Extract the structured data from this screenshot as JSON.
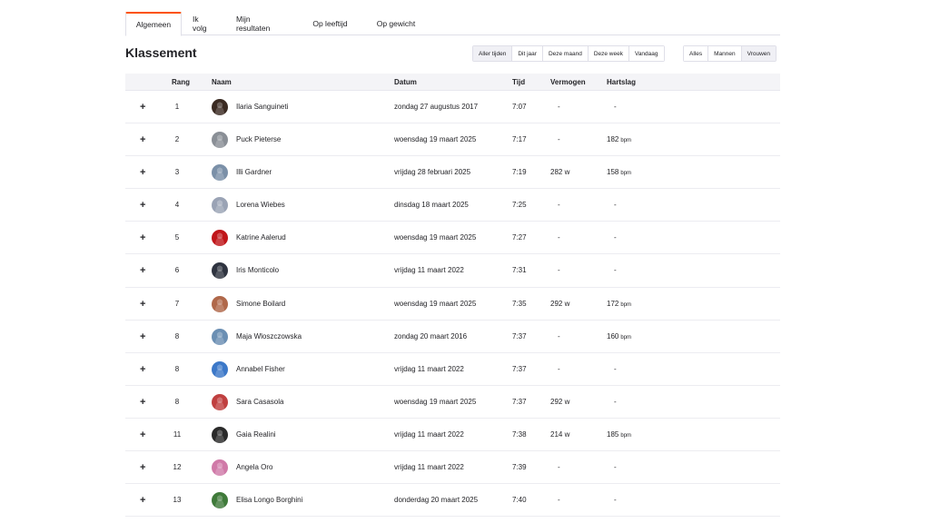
{
  "tabs": [
    "Algemeen",
    "Ik volg",
    "Mijn resultaten",
    "Op leeftijd",
    "Op gewicht"
  ],
  "page_title": "Klassement",
  "time_filters": [
    "Aller tijden",
    "Dit jaar",
    "Deze maand",
    "Deze week",
    "Vandaag"
  ],
  "gender_filters": [
    "Alles",
    "Mannen",
    "Vrouwen"
  ],
  "columns": {
    "rank": "Rang",
    "name": "Naam",
    "date": "Datum",
    "time": "Tijd",
    "power": "Vermogen",
    "hr": "Hartslag"
  },
  "expand_symbol": "+",
  "rows": [
    {
      "rank": "1",
      "name": "Ilaria Sanguineti",
      "date": "zondag 27 augustus 2017",
      "time": "7:07",
      "power": "-",
      "hr": "-",
      "hr_unit": "",
      "avatar_color": "#3a2a22"
    },
    {
      "rank": "2",
      "name": "Puck Pieterse",
      "date": "woensdag 19 maart 2025",
      "time": "7:17",
      "power": "-",
      "hr": "182",
      "hr_unit": "bpm",
      "avatar_color": "#8a8f96"
    },
    {
      "rank": "3",
      "name": "Illi Gardner",
      "date": "vrijdag 28 februari 2025",
      "time": "7:19",
      "power": "282 w",
      "hr": "158",
      "hr_unit": "bpm",
      "avatar_color": "#7b90a8"
    },
    {
      "rank": "4",
      "name": "Lorena Wiebes",
      "date": "dinsdag 18 maart 2025",
      "time": "7:25",
      "power": "-",
      "hr": "-",
      "hr_unit": "",
      "avatar_color": "#9aa3b5"
    },
    {
      "rank": "5",
      "name": "Katrine Aalerud",
      "date": "woensdag 19 maart 2025",
      "time": "7:27",
      "power": "-",
      "hr": "-",
      "hr_unit": "",
      "avatar_color": "#c0161a"
    },
    {
      "rank": "6",
      "name": "Iris Monticolo",
      "date": "vrijdag 11 maart 2022",
      "time": "7:31",
      "power": "-",
      "hr": "-",
      "hr_unit": "",
      "avatar_color": "#2f3440"
    },
    {
      "rank": "7",
      "name": "Simone Boilard",
      "date": "woensdag 19 maart 2025",
      "time": "7:35",
      "power": "292 w",
      "hr": "172",
      "hr_unit": "bpm",
      "avatar_color": "#b0684a"
    },
    {
      "rank": "8",
      "name": "Maja Wloszczowska",
      "date": "zondag 20 maart 2016",
      "time": "7:37",
      "power": "-",
      "hr": "160",
      "hr_unit": "bpm",
      "avatar_color": "#6b8fb3"
    },
    {
      "rank": "8",
      "name": "Annabel Fisher",
      "date": "vrijdag 11 maart 2022",
      "time": "7:37",
      "power": "-",
      "hr": "-",
      "hr_unit": "",
      "avatar_color": "#3c78c8"
    },
    {
      "rank": "8",
      "name": "Sara Casasola",
      "date": "woensdag 19 maart 2025",
      "time": "7:37",
      "power": "292 w",
      "hr": "-",
      "hr_unit": "",
      "avatar_color": "#c04040"
    },
    {
      "rank": "11",
      "name": "Gaia Realini",
      "date": "vrijdag 11 maart 2022",
      "time": "7:38",
      "power": "214 w",
      "hr": "185",
      "hr_unit": "bpm",
      "avatar_color": "#2a2a2a"
    },
    {
      "rank": "12",
      "name": "Angela Oro",
      "date": "vrijdag 11 maart 2022",
      "time": "7:39",
      "power": "-",
      "hr": "-",
      "hr_unit": "",
      "avatar_color": "#d07aa8"
    },
    {
      "rank": "13",
      "name": "Elisa Longo Borghini",
      "date": "donderdag 20 maart 2025",
      "time": "7:40",
      "power": "-",
      "hr": "-",
      "hr_unit": "",
      "avatar_color": "#3f7a3a"
    }
  ],
  "colors": {
    "accent": "#fc5200",
    "header_bg": "#f4f4f7",
    "border": "#dfdfe8",
    "text": "#242428"
  }
}
